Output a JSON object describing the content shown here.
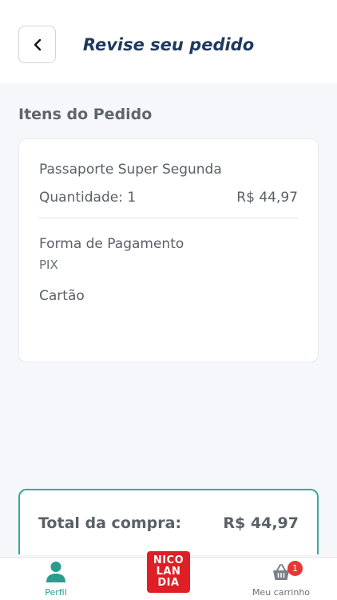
{
  "header": {
    "title": "Revise seu pedido"
  },
  "section": {
    "title": "Itens do Pedido"
  },
  "order": {
    "product_name": "Passaporte Super Segunda",
    "quantity_text": "Quantidade: 1",
    "price": "R$ 44,97",
    "payment_label": "Forma de Pagamento",
    "payment_options": [
      "PIX",
      "Cartão"
    ]
  },
  "total": {
    "label": "Total da compra:",
    "value": "R$ 44,97"
  },
  "nav": {
    "profile_label": "Perfil",
    "logo_lines": [
      "NICO",
      "LAN",
      "DIA"
    ],
    "cart_label": "Meu carrinho",
    "cart_badge": "1"
  },
  "colors": {
    "accent": "#2a9d8f",
    "title": "#1e3a5f",
    "badge": "#e53935",
    "logo": "#e01e26"
  }
}
